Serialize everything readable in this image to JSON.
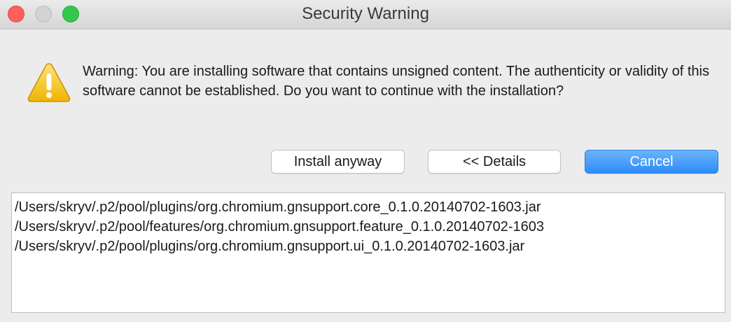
{
  "window": {
    "title": "Security Warning"
  },
  "dialog": {
    "icon": "warning-triangle-icon",
    "message": "Warning: You are installing software that contains unsigned content. The authenticity or validity of this software cannot be established. Do you want to continue with the installation?"
  },
  "buttons": {
    "install_label": "Install anyway",
    "details_label": "<< Details",
    "cancel_label": "Cancel"
  },
  "files": [
    "/Users/skryv/.p2/pool/plugins/org.chromium.gnsupport.core_0.1.0.20140702-1603.jar",
    "/Users/skryv/.p2/pool/features/org.chromium.gnsupport.feature_0.1.0.20140702-1603",
    "/Users/skryv/.p2/pool/plugins/org.chromium.gnsupport.ui_0.1.0.20140702-1603.jar"
  ],
  "colors": {
    "accent": "#2d8df8",
    "close": "#fc605c",
    "zoom": "#34c84a",
    "warning": "#f5c518"
  }
}
